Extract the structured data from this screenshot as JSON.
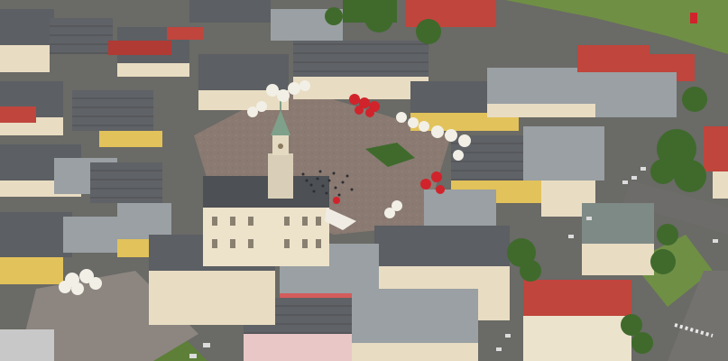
{
  "scene": {
    "subject": "aerial-old-town-square",
    "colors": {
      "plaza": "#8a7a72",
      "roof_grey": "#5c5f63",
      "roof_light": "#9aa0a3",
      "roof_red": "#c0453c",
      "facade_cream": "#e8dcc2",
      "facade_yellow": "#e2c25a",
      "tree": "#3f6a2c",
      "grass": "#6f8f45",
      "road": "#6e6c6a",
      "tower": "#d9cfb8",
      "tower_dome": "#7fa08a",
      "umbrella_white": "#f2efe6",
      "umbrella_red": "#d1232b"
    }
  }
}
